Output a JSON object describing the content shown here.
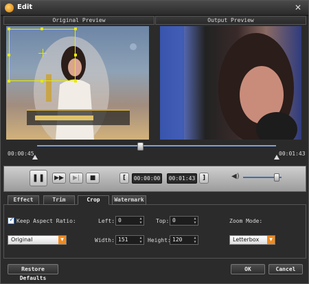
{
  "window": {
    "title": "Edit"
  },
  "preview": {
    "original_label": "Original Preview",
    "output_label": "Output Preview"
  },
  "timeline": {
    "start_time": "00:00:45",
    "end_time": "00:01:43",
    "position": 0.43
  },
  "controls": {
    "start_box": "00:00:00",
    "end_box": "00:01:43",
    "volume": 0.88
  },
  "tabs": [
    {
      "label": "Effect"
    },
    {
      "label": "Trim"
    },
    {
      "label": "Crop",
      "active": true
    },
    {
      "label": "Watermark"
    }
  ],
  "crop": {
    "keep_aspect_label": "Keep Aspect Ratio:",
    "keep_aspect_checked": true,
    "aspect_value": "Original",
    "left_label": "Left:",
    "left_value": "0",
    "top_label": "Top:",
    "top_value": "0",
    "width_label": "Width:",
    "width_value": "151",
    "height_label": "Height:",
    "height_value": "120",
    "zoom_label": "Zoom Mode:",
    "zoom_value": "Letterbox"
  },
  "footer": {
    "restore_label": "Restore Defaults",
    "ok_label": "OK",
    "cancel_label": "Cancel"
  },
  "colors": {
    "crop_frame": "#e7e900",
    "accent": "#f08a1d",
    "track": "#7ca2d8"
  }
}
